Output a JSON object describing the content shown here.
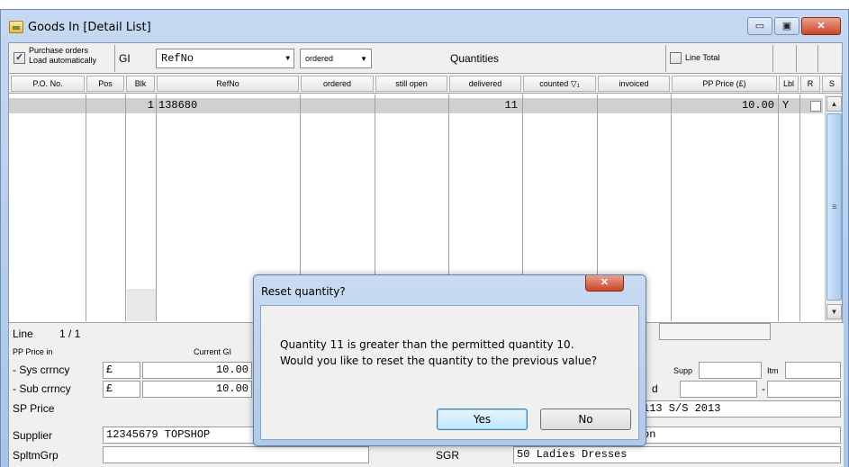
{
  "window": {
    "title": "Goods In [Detail List]",
    "controls": {
      "minimize": "▭",
      "maximize": "▣",
      "close": "✕"
    }
  },
  "toolbar": {
    "purchase_orders_label": "Purchase orders",
    "load_auto_label": "Load automatically",
    "purchase_orders_checked": true,
    "gi_label": "GI",
    "refno_combo_value": "RefNo",
    "ordered_combo_value": "ordered",
    "quantities_label": "Quantities",
    "line_total_label": "Line Total",
    "line_total_checked": false
  },
  "columns": [
    "P.O. No.",
    "Pos",
    "Blk",
    "RefNo",
    "ordered",
    "still open",
    "delivered",
    "counted ▽₁",
    "invoiced",
    "PP Price (£)",
    "Lbl",
    "R",
    "S"
  ],
  "rows": [
    {
      "po": "",
      "pos": "",
      "blk": "1",
      "refno": "138680",
      "ordered": "",
      "still_open": "",
      "delivered": "11",
      "counted": "",
      "invoiced": "",
      "pp_price": "10.00",
      "lbl": "Y",
      "r_checked": false
    }
  ],
  "lower": {
    "line_label": "Line",
    "line_value": "1 / 1",
    "pp_price_in_label": "PP Price in",
    "current_gi_label": "Current GI",
    "sys_label": "- Sys crrncy",
    "sys_currency": "£",
    "sys_value": "10.00",
    "sub_label": "- Sub crrncy",
    "sub_currency": "£",
    "sub_value": "10.00",
    "sp_price_label": "SP Price",
    "supplier_label": "Supplier",
    "supplier_value": "12345679 TOPSHOP",
    "spltmgrp_label": "SpltmGrp",
    "supp_label": "Supp",
    "itm_label": "Itm",
    "dash": "-",
    "season_value": "113 S/S 2013",
    "hidden_char": "d",
    "on_value": "on",
    "sgr_label": "SGR",
    "sgr_value": "50 Ladies Dresses"
  },
  "dialog": {
    "title": "Reset quantity?",
    "close_label": "✕",
    "message_line1": "Quantity 11 is greater than the permitted quantity 10.",
    "message_line2": "Would you like to reset the quantity to the previous value?",
    "yes_label": "Yes",
    "no_label": "No"
  }
}
